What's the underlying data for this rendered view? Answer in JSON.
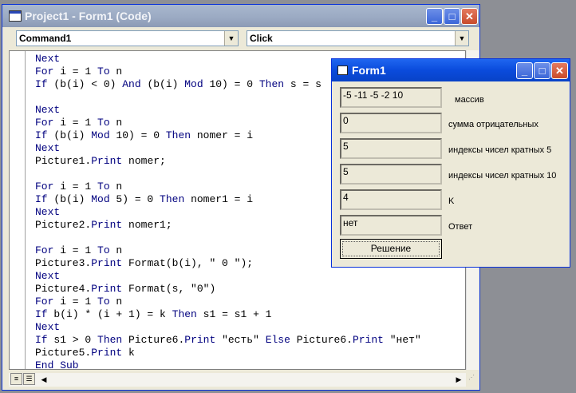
{
  "code_window": {
    "title": "Project1 - Form1 (Code)",
    "object_combo": "Command1",
    "proc_combo": "Click"
  },
  "code_lines": [
    [
      [
        "",
        "Next",
        "kw"
      ]
    ],
    [
      [
        "",
        "For",
        "kw"
      ],
      [
        " i = 1 ",
        "",
        ""
      ],
      [
        "",
        "To",
        "kw"
      ],
      [
        " n",
        "",
        ""
      ]
    ],
    [
      [
        "",
        "If",
        "kw"
      ],
      [
        " (b(i) < 0) ",
        "",
        ""
      ],
      [
        "",
        "And",
        "kw"
      ],
      [
        " (b(i) ",
        "",
        ""
      ],
      [
        "",
        "Mod",
        "kw"
      ],
      [
        " 10) = 0 ",
        "",
        ""
      ],
      [
        "",
        "Then",
        "kw"
      ],
      [
        " s = s",
        "",
        ""
      ]
    ],
    [],
    [
      [
        "",
        "Next",
        "kw"
      ]
    ],
    [
      [
        "",
        "For",
        "kw"
      ],
      [
        " i = 1 ",
        "",
        ""
      ],
      [
        "",
        "To",
        "kw"
      ],
      [
        " n",
        "",
        ""
      ]
    ],
    [
      [
        "",
        "If",
        "kw"
      ],
      [
        " (b(i) ",
        "",
        ""
      ],
      [
        "",
        "Mod",
        "kw"
      ],
      [
        " 10) = 0 ",
        "",
        ""
      ],
      [
        "",
        "Then",
        "kw"
      ],
      [
        " nomer = i",
        "",
        ""
      ]
    ],
    [
      [
        "",
        "Next",
        "kw"
      ]
    ],
    [
      [
        "Picture1.",
        "",
        ""
      ],
      [
        "",
        "Print",
        "kw"
      ],
      [
        " nomer;",
        "",
        ""
      ]
    ],
    [],
    [
      [
        "",
        "For",
        "kw"
      ],
      [
        " i = 1 ",
        "",
        ""
      ],
      [
        "",
        "To",
        "kw"
      ],
      [
        " n",
        "",
        ""
      ]
    ],
    [
      [
        "",
        "If",
        "kw"
      ],
      [
        " (b(i) ",
        "",
        ""
      ],
      [
        "",
        "Mod",
        "kw"
      ],
      [
        " 5) = 0 ",
        "",
        ""
      ],
      [
        "",
        "Then",
        "kw"
      ],
      [
        " nomer1 = i",
        "",
        ""
      ]
    ],
    [
      [
        "",
        "Next",
        "kw"
      ]
    ],
    [
      [
        "Picture2.",
        "",
        ""
      ],
      [
        "",
        "Print",
        "kw"
      ],
      [
        " nomer1;",
        "",
        ""
      ]
    ],
    [],
    [
      [
        "",
        "For",
        "kw"
      ],
      [
        " i = 1 ",
        "",
        ""
      ],
      [
        "",
        "To",
        "kw"
      ],
      [
        " n",
        "",
        ""
      ]
    ],
    [
      [
        "Picture3.",
        "",
        ""
      ],
      [
        "",
        "Print",
        "kw"
      ],
      [
        " Format(b(i), \" 0 \");",
        "",
        ""
      ]
    ],
    [
      [
        "",
        "Next",
        "kw"
      ]
    ],
    [
      [
        "Picture4.",
        "",
        ""
      ],
      [
        "",
        "Print",
        "kw"
      ],
      [
        " Format(s, \"0\")",
        "",
        ""
      ]
    ],
    [
      [
        "",
        "For",
        "kw"
      ],
      [
        " i = 1 ",
        "",
        ""
      ],
      [
        "",
        "To",
        "kw"
      ],
      [
        " n",
        "",
        ""
      ]
    ],
    [
      [
        "",
        "If",
        "kw"
      ],
      [
        " b(i) * (i + 1) = k ",
        "",
        ""
      ],
      [
        "",
        "Then",
        "kw"
      ],
      [
        " s1 = s1 + 1",
        "",
        ""
      ]
    ],
    [
      [
        "",
        "Next",
        "kw"
      ]
    ],
    [
      [
        "",
        "If",
        "kw"
      ],
      [
        " s1 > 0 ",
        "",
        ""
      ],
      [
        "",
        "Then",
        "kw"
      ],
      [
        " Picture6.",
        "",
        ""
      ],
      [
        "",
        "Print",
        "kw"
      ],
      [
        " \"есть\" ",
        "",
        ""
      ],
      [
        "",
        "Else",
        "kw"
      ],
      [
        " Picture6.",
        "",
        ""
      ],
      [
        "",
        "Print",
        "kw"
      ],
      [
        " \"нет\"",
        "",
        ""
      ]
    ],
    [
      [
        "Picture5.",
        "",
        ""
      ],
      [
        "",
        "Print",
        "kw"
      ],
      [
        " k",
        "",
        ""
      ]
    ],
    [
      [
        "",
        "End Sub",
        "kw"
      ]
    ]
  ],
  "form1": {
    "title": "Form1",
    "rows": [
      {
        "value": "-5 -11 -5 -2  10",
        "label": "массив"
      },
      {
        "value": "0",
        "label": "сумма отрицательных"
      },
      {
        "value": "5",
        "label": "индексы чисел кратных 5"
      },
      {
        "value": " 5",
        "label": "индексы чисел кратных 10"
      },
      {
        "value": "4",
        "label": "K"
      },
      {
        "value": "нет",
        "label": "Ответ"
      }
    ],
    "button_label": "Решение"
  },
  "icons": {
    "minimize": "minimize-icon",
    "maximize": "maximize-icon",
    "close": "close-icon"
  },
  "colors": {
    "keyword": "#00007f",
    "active_title": "#0a4bdc",
    "inactive_title": "#9aa9c2"
  }
}
